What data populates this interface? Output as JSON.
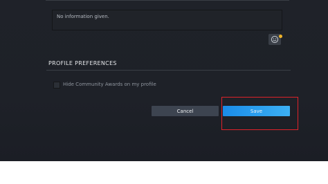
{
  "summary": {
    "text": "No information given."
  },
  "emoji_picker": {
    "icon": "smiley-icon",
    "badge_color": "#f0b429"
  },
  "preferences": {
    "title": "PROFILE PREFERENCES",
    "hide_awards_label": "Hide Community Awards on my profile",
    "hide_awards_checked": false
  },
  "actions": {
    "cancel_label": "Cancel",
    "save_label": "Save"
  },
  "colors": {
    "background": "#1f2229",
    "save_button": "#1a8ce8",
    "cancel_button": "#3d4450",
    "highlight": "#e0222a"
  }
}
